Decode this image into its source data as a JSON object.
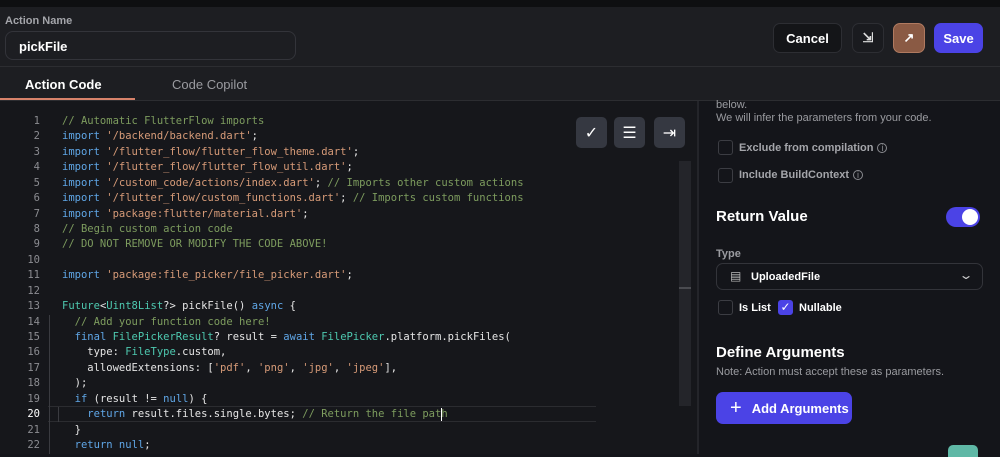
{
  "header": {
    "action_name_label": "Action Name",
    "action_name_value": "pickFile",
    "cancel_label": "Cancel",
    "save_label": "Save"
  },
  "tabs": [
    {
      "label": "Action Code",
      "active": true
    },
    {
      "label": "Code Copilot",
      "active": false
    }
  ],
  "editor": {
    "active_line": 20,
    "lines": [
      [
        [
          "cm",
          "// Automatic FlutterFlow imports"
        ]
      ],
      [
        [
          "kw",
          "import"
        ],
        [
          "tx",
          " "
        ],
        [
          "str",
          "'/backend/backend.dart'"
        ],
        [
          "tx",
          ";"
        ]
      ],
      [
        [
          "kw",
          "import"
        ],
        [
          "tx",
          " "
        ],
        [
          "str",
          "'/flutter_flow/flutter_flow_theme.dart'"
        ],
        [
          "tx",
          ";"
        ]
      ],
      [
        [
          "kw",
          "import"
        ],
        [
          "tx",
          " "
        ],
        [
          "str",
          "'/flutter_flow/flutter_flow_util.dart'"
        ],
        [
          "tx",
          ";"
        ]
      ],
      [
        [
          "kw",
          "import"
        ],
        [
          "tx",
          " "
        ],
        [
          "str",
          "'/custom_code/actions/index.dart'"
        ],
        [
          "tx",
          "; "
        ],
        [
          "cm",
          "// Imports other custom actions"
        ]
      ],
      [
        [
          "kw",
          "import"
        ],
        [
          "tx",
          " "
        ],
        [
          "str",
          "'/flutter_flow/custom_functions.dart'"
        ],
        [
          "tx",
          "; "
        ],
        [
          "cm",
          "// Imports custom functions"
        ]
      ],
      [
        [
          "kw",
          "import"
        ],
        [
          "tx",
          " "
        ],
        [
          "str",
          "'package:flutter/material.dart'"
        ],
        [
          "tx",
          ";"
        ]
      ],
      [
        [
          "cm",
          "// Begin custom action code"
        ]
      ],
      [
        [
          "cm",
          "// DO NOT REMOVE OR MODIFY THE CODE ABOVE!"
        ]
      ],
      [],
      [
        [
          "kw",
          "import"
        ],
        [
          "tx",
          " "
        ],
        [
          "str",
          "'package:file_picker/file_picker.dart'"
        ],
        [
          "tx",
          ";"
        ]
      ],
      [],
      [
        [
          "ty",
          "Future"
        ],
        [
          "tx",
          "<"
        ],
        [
          "ty",
          "Uint8List"
        ],
        [
          "tx",
          "?> pickFile() "
        ],
        [
          "kw",
          "async"
        ],
        [
          "tx",
          " {"
        ]
      ],
      [
        [
          "tx",
          "  "
        ],
        [
          "cm",
          "// Add your function code here!"
        ]
      ],
      [
        [
          "tx",
          "  "
        ],
        [
          "kw",
          "final"
        ],
        [
          "tx",
          " "
        ],
        [
          "ty",
          "FilePickerResult"
        ],
        [
          "tx",
          "? result = "
        ],
        [
          "kw",
          "await"
        ],
        [
          "tx",
          " "
        ],
        [
          "ty",
          "FilePicker"
        ],
        [
          "tx",
          ".platform.pickFiles("
        ]
      ],
      [
        [
          "tx",
          "    type: "
        ],
        [
          "ty",
          "FileType"
        ],
        [
          "tx",
          ".custom,"
        ]
      ],
      [
        [
          "tx",
          "    allowedExtensions: ["
        ],
        [
          "str",
          "'pdf'"
        ],
        [
          "tx",
          ", "
        ],
        [
          "str",
          "'png'"
        ],
        [
          "tx",
          ", "
        ],
        [
          "str",
          "'jpg'"
        ],
        [
          "tx",
          ", "
        ],
        [
          "str",
          "'jpeg'"
        ],
        [
          "tx",
          "],"
        ]
      ],
      [
        [
          "tx",
          "  );"
        ]
      ],
      [
        [
          "tx",
          "  "
        ],
        [
          "kw",
          "if"
        ],
        [
          "tx",
          " (result != "
        ],
        [
          "kw",
          "null"
        ],
        [
          "tx",
          ") {"
        ]
      ],
      [
        [
          "tx",
          "    "
        ],
        [
          "kw",
          "return"
        ],
        [
          "tx",
          " result.files.single.bytes; "
        ],
        [
          "cm",
          "// Return the file path"
        ]
      ],
      [
        [
          "tx",
          "  }"
        ]
      ],
      [
        [
          "tx",
          "  "
        ],
        [
          "kw",
          "return"
        ],
        [
          "tx",
          " "
        ],
        [
          "kw",
          "null"
        ],
        [
          "tx",
          ";"
        ]
      ]
    ]
  },
  "right_panel": {
    "hint_line1": "below.",
    "hint_line2": "We will infer the parameters from your code.",
    "exclude_label": "Exclude from compilation",
    "build_context_label": "Include BuildContext",
    "return_value_title": "Return Value",
    "return_value_enabled": true,
    "type_label": "Type",
    "type_value": "UploadedFile",
    "is_list_label": "Is List",
    "is_list_checked": false,
    "nullable_label": "Nullable",
    "nullable_checked": true,
    "define_args_title": "Define Arguments",
    "define_args_note": "Note: Action must accept these as parameters.",
    "add_args_label": "Add Arguments"
  },
  "colors": {
    "accent": "#4b43e6",
    "tab_underline": "#d7826a",
    "open_button": "#8a5a44"
  }
}
